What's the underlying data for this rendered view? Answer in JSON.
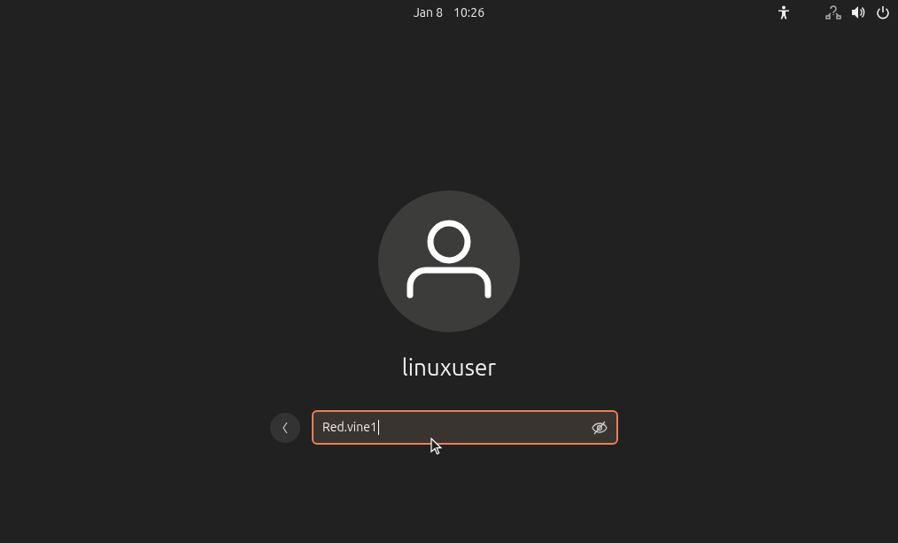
{
  "top_bar": {
    "date": "Jan 8",
    "time": "10:26"
  },
  "user": {
    "name": "linuxuser"
  },
  "password": {
    "value": "Red.vine1",
    "focused": true
  }
}
